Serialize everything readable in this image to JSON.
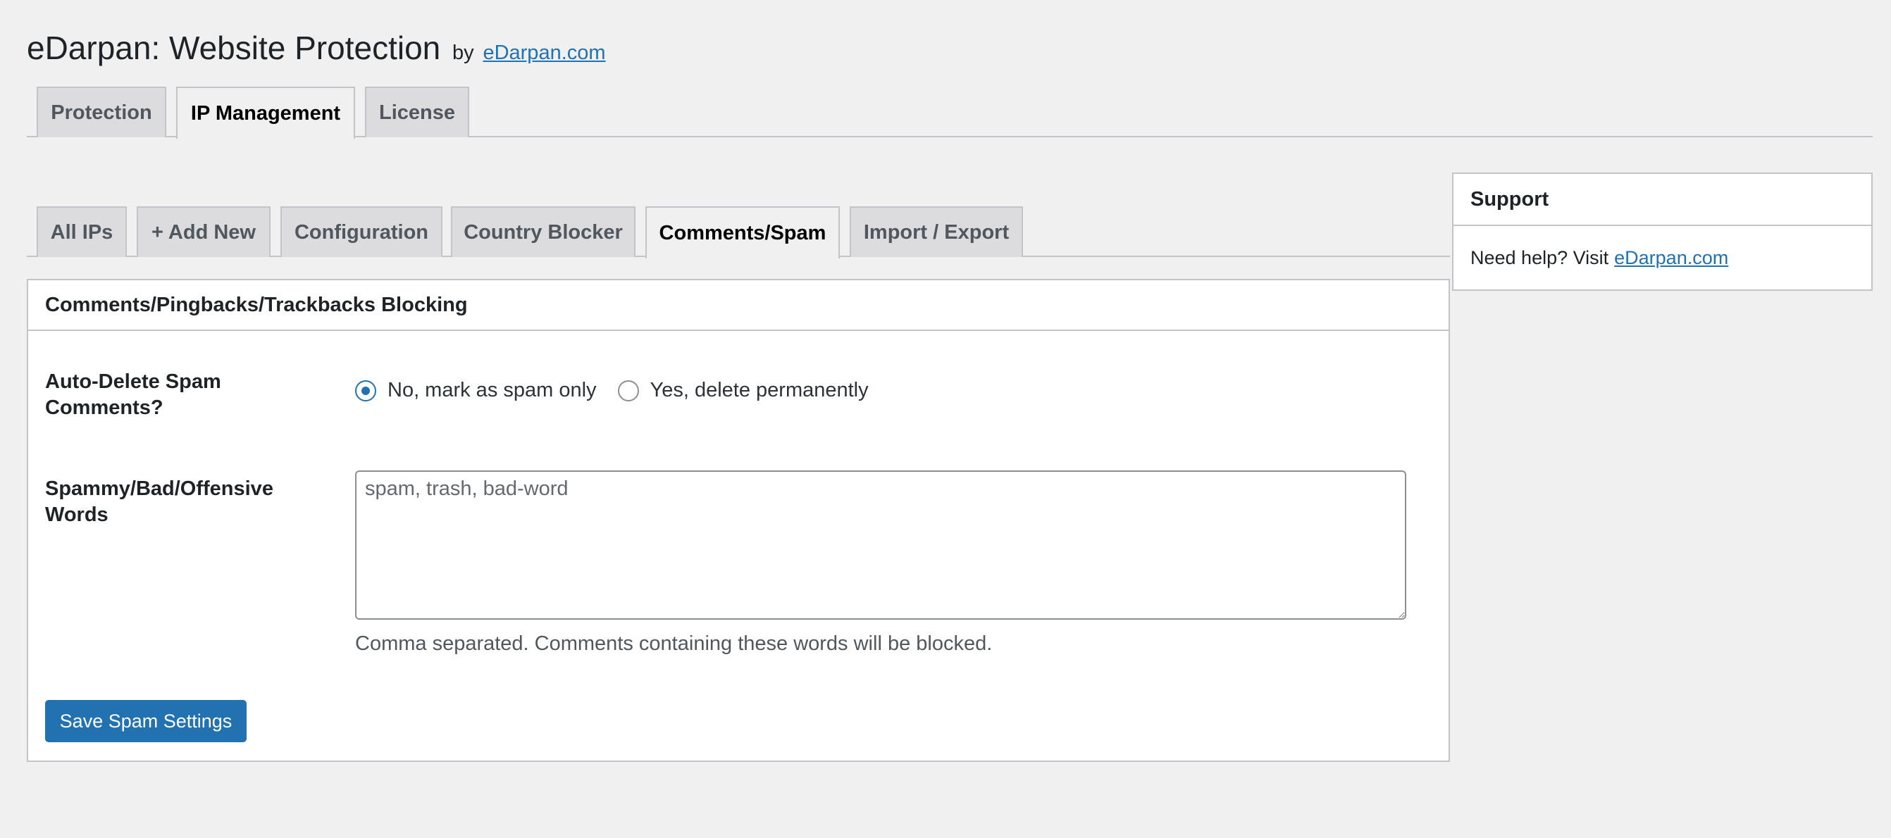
{
  "header": {
    "title": "eDarpan: Website Protection",
    "by": "by",
    "link_text": "eDarpan.com"
  },
  "main_tabs": [
    {
      "label": "Protection",
      "active": false
    },
    {
      "label": "IP Management",
      "active": true
    },
    {
      "label": "License",
      "active": false
    }
  ],
  "sub_tabs": [
    {
      "label": "All IPs",
      "active": false
    },
    {
      "label": "+ Add New",
      "active": false
    },
    {
      "label": "Configuration",
      "active": false
    },
    {
      "label": "Country Blocker",
      "active": false
    },
    {
      "label": "Comments/Spam",
      "active": true
    },
    {
      "label": "Import / Export",
      "active": false
    }
  ],
  "panel": {
    "title": "Comments/Pingbacks/Trackbacks Blocking",
    "auto_delete": {
      "label": "Auto-Delete Spam Comments?",
      "options": [
        {
          "label": "No, mark as spam only",
          "checked": true
        },
        {
          "label": "Yes, delete permanently",
          "checked": false
        }
      ]
    },
    "words": {
      "label": "Spammy/Bad/Offensive Words",
      "placeholder": "spam, trash, bad-word",
      "value": "",
      "description": "Comma separated. Comments containing these words will be blocked."
    },
    "save_label": "Save Spam Settings"
  },
  "support": {
    "title": "Support",
    "text": "Need help? Visit",
    "link_text": "eDarpan.com"
  },
  "colors": {
    "accent": "#2271b1",
    "background": "#f0f0f1",
    "border": "#c3c4c7"
  }
}
